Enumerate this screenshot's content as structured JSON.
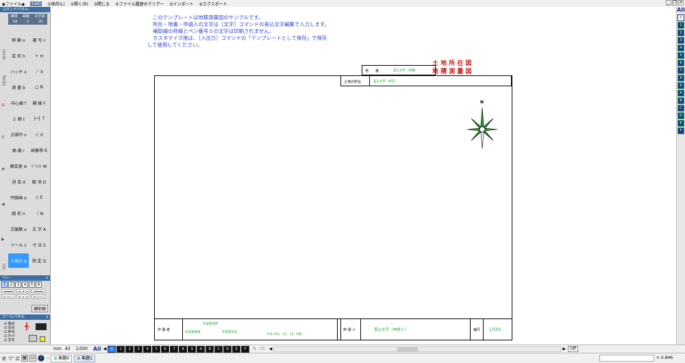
{
  "menubar": {
    "items": [
      "◆ファイル◆",
      "CAD",
      "①保存(L)",
      "②開く(R)",
      "③閉じる",
      "④ファイル履歴のクリアー",
      "⑤インポート",
      "⑥エクスポート"
    ],
    "active_index": 1
  },
  "cmd_panel": {
    "title": "コマンドパネル",
    "coord_headers": [
      "線領",
      "曲線",
      "文字割"
    ],
    "coord_values": [
      "SX",
      "0",
      "20"
    ],
    "side_labels": [
      "Undo",
      "Redo",
      "CE",
      "Uic"
    ],
    "buttons": [
      [
        "移 動 o",
        "複 写 c"
      ],
      [
        "変 形 h",
        "＋ H"
      ],
      [
        "ハッチ x",
        "／ X"
      ],
      [
        "測 量 b",
        "□ B"
      ],
      [
        "中心線 f",
        "補 線 F"
      ],
      [
        "２ 線 t",
        "├─┤ T"
      ],
      [
        "点操作 v",
        "＜ V"
      ],
      [
        "曲 線 r",
        "画像等 R"
      ],
      [
        "線変更 w",
        "ﾍﾟｲﾝﾄ W"
      ],
      [
        "消 去 d",
        "線 消 D"
      ],
      [
        "円描画 e",
        "○ E"
      ],
      [
        "図 形 n",
        "〈 N"
      ],
      [
        "文編集 a",
        "文 字 A"
      ],
      [
        "ツール s",
        "寸 法 S"
      ],
      [
        "入出力 q",
        "測 定 Q"
      ]
    ],
    "active_button": "入出力 q"
  },
  "pen_panel": {
    "title": "ペン",
    "numbers": [
      "1",
      "2",
      "3",
      "4",
      "5",
      "6"
    ],
    "selected": "1",
    "aux_label": "補助線"
  },
  "tool_panel": {
    "title": "ツールパネル",
    "checks": [
      "端点",
      "交点",
      "終点",
      "ｸﾘｯﾄﾞ",
      "文字"
    ]
  },
  "notes": {
    "line1": "このテンプレートは地積測量図のサンプルです。",
    "line2": "所在・地番・申請人の文字は［文字］コマンドの差込文字編集で入力します。",
    "line3": "補助線の枠線とペン番号０の文字は印刷されません。",
    "line4": "カスタマイズ後は、［入出力］コマンドの「テンプレートとして保存」で保存",
    "line5": "して使用してください。"
  },
  "titles": {
    "t1": "土 地 所 在 図",
    "t2": "地 積 測 量 図"
  },
  "header_table": {
    "chiban_label": "地　　番",
    "chiban_value": "差込文字（地番）",
    "shozai_label": "土地の所在",
    "shozai_value": "差込文字（所在）"
  },
  "north": "N",
  "footer": {
    "author_label": "作 製 者",
    "author_line1": "作成者住所",
    "author_line2_a": "作成者資格",
    "author_line2_b": "作成者氏名",
    "date": "（平成 20年　1月　18　作製）",
    "applicant_label": "申 請 人",
    "applicant_value": "差込文字（申請人）",
    "scale_label": "縮尺",
    "scale_value": "1/500"
  },
  "right_bar": {
    "all_label": "All",
    "buttons": [
      "0",
      "1",
      "2",
      "3",
      "4",
      "5",
      "6",
      "7",
      "8",
      "9",
      "A",
      "B",
      "C",
      "D",
      "E",
      "F"
    ]
  },
  "layer_bar": {
    "zoom_label": "mm",
    "paper": "A3",
    "scale": "1/500",
    "all_label": "All",
    "layers": [
      "0",
      "1",
      "2",
      "3",
      "4",
      "5",
      "6",
      "7",
      "8",
      "9",
      "A",
      "B",
      "C",
      "D",
      "E",
      "F"
    ],
    "selected_layer": "0",
    "off_label": "Off"
  },
  "status_bar": {
    "left_text": "状「厂 広",
    "tab1": "無題0",
    "tab2": "無題1",
    "coord": "× 0.846"
  },
  "colors": {
    "note_blue": "#3344cc",
    "title_red": "#cc2222",
    "plate_green": "#22aa33",
    "active_blue": "#3399ff"
  }
}
